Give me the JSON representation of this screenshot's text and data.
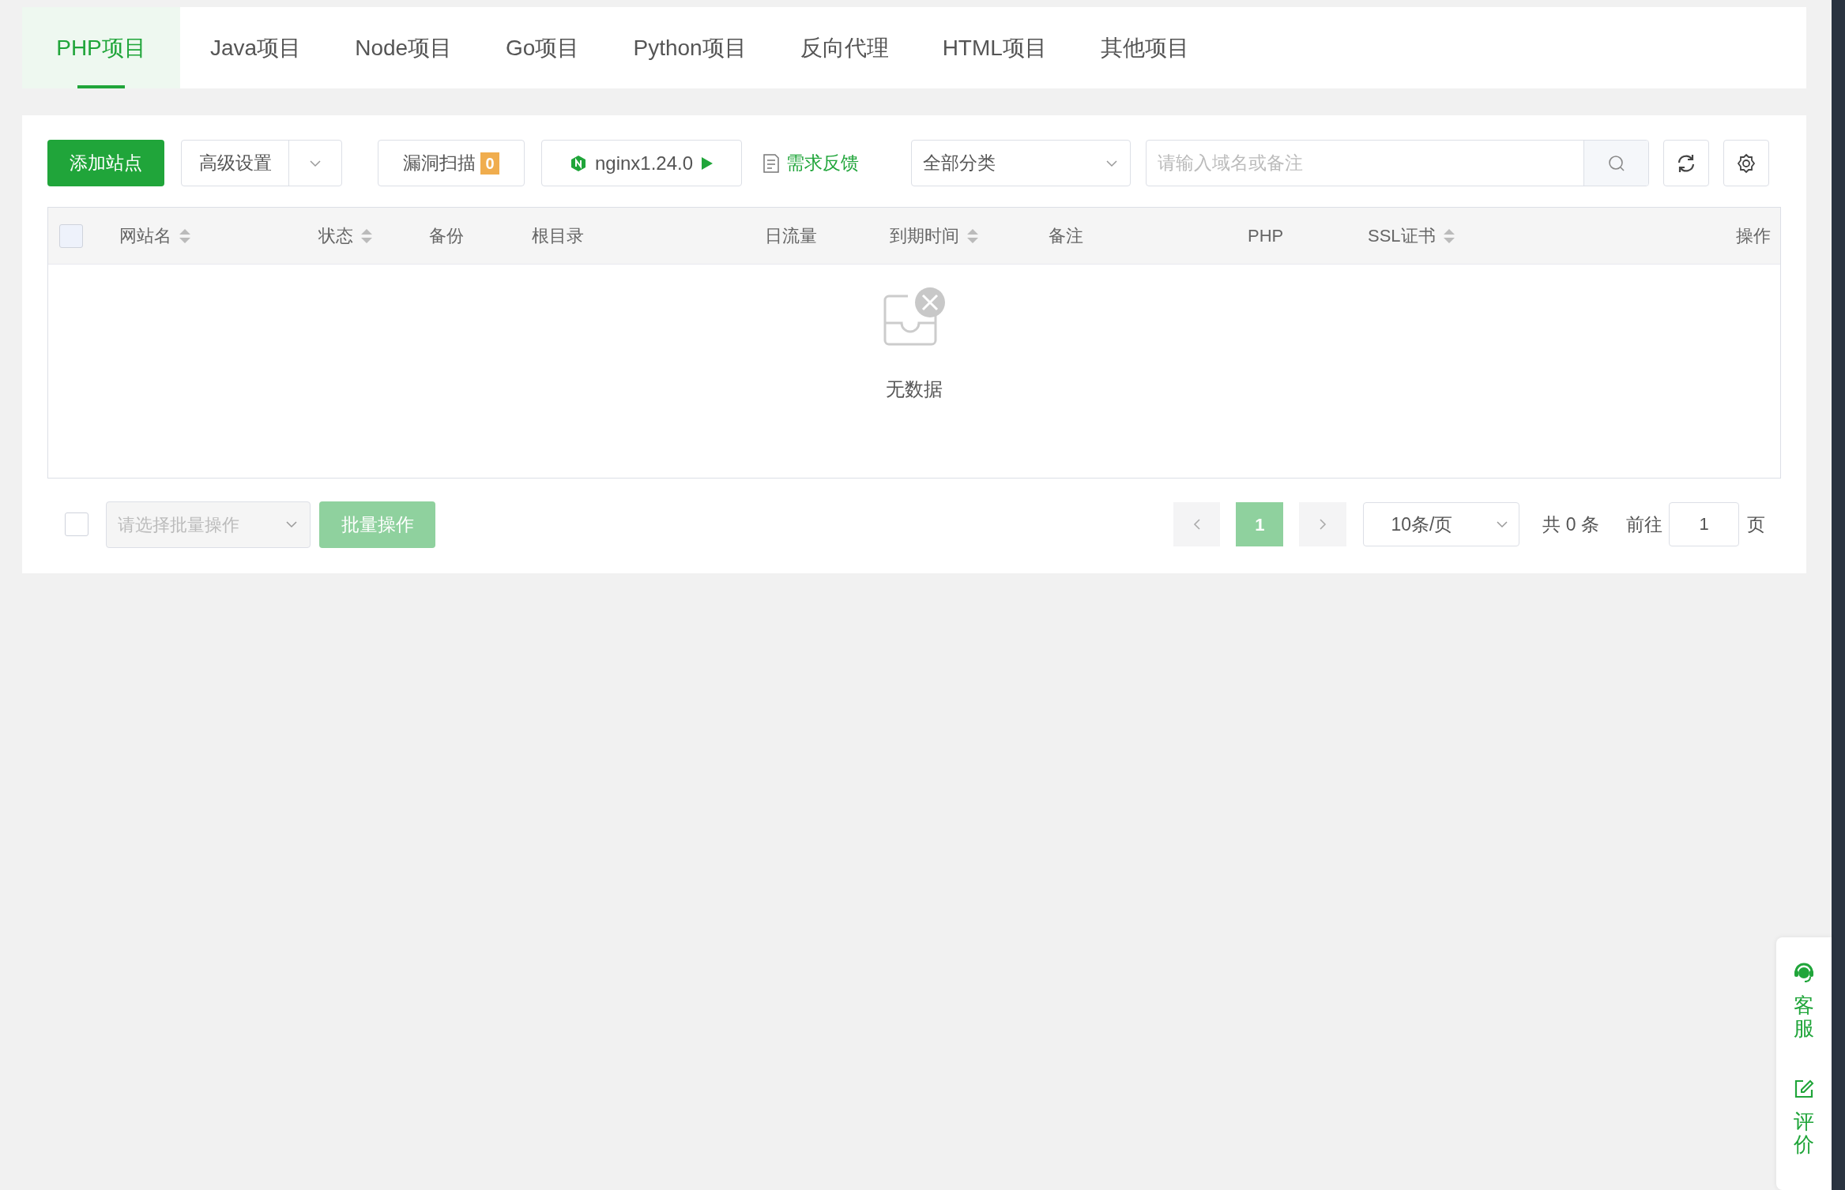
{
  "tabs": [
    {
      "label": "PHP项目",
      "selected": true
    },
    {
      "label": "Java项目",
      "selected": false
    },
    {
      "label": "Node项目",
      "selected": false
    },
    {
      "label": "Go项目",
      "selected": false
    },
    {
      "label": "Python项目",
      "selected": false
    },
    {
      "label": "反向代理",
      "selected": false
    },
    {
      "label": "HTML项目",
      "selected": false
    },
    {
      "label": "其他项目",
      "selected": false
    }
  ],
  "toolbar": {
    "add_button": "添加站点",
    "advanced_button": "高级设置",
    "scan_button": {
      "label": "漏洞扫描",
      "count": "0"
    },
    "server_button": "nginx1.24.0",
    "feedback_link": "需求反馈",
    "category_select": "全部分类",
    "search": {
      "placeholder": "请输入域名或备注"
    }
  },
  "table": {
    "select_all_checked": false,
    "columns": [
      {
        "label": "网站名",
        "sortable": true
      },
      {
        "label": "状态",
        "sortable": true
      },
      {
        "label": "备份",
        "sortable": false
      },
      {
        "label": "根目录",
        "sortable": false
      },
      {
        "label": "日流量",
        "sortable": false
      },
      {
        "label": "到期时间",
        "sortable": true
      },
      {
        "label": "备注",
        "sortable": false
      },
      {
        "label": "PHP",
        "sortable": false
      },
      {
        "label": "SSL证书",
        "sortable": true
      },
      {
        "label": "操作",
        "sortable": false
      }
    ],
    "empty_text": "无数据"
  },
  "footer": {
    "select_checked": false,
    "batch_select": {
      "placeholder": "请选择批量操作"
    },
    "batch_button": {
      "label": "批量操作",
      "disabled": true
    },
    "pagination": {
      "pages": [
        {
          "label": "1",
          "selected": true
        }
      ],
      "page_size": "10条/页",
      "total": "共 0 条",
      "goto_label": "前往",
      "goto_value": "1",
      "page_unit": "页"
    }
  },
  "float_panel": {
    "items": [
      {
        "kind": "support",
        "label": "客服"
      },
      {
        "kind": "review",
        "label": "评价"
      }
    ]
  }
}
